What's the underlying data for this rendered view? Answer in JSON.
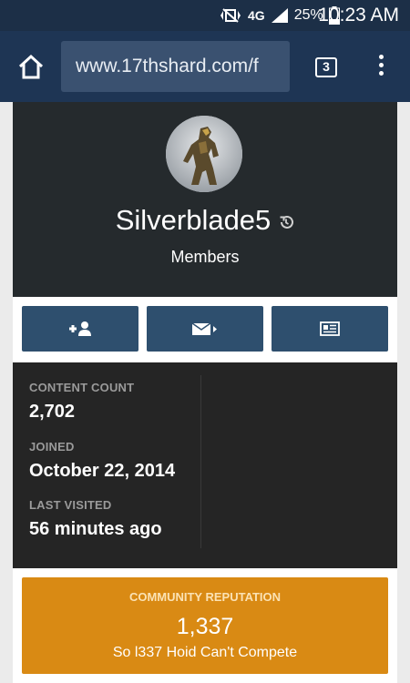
{
  "status_bar": {
    "network": "4G",
    "battery": "25%",
    "time": "10:23 AM"
  },
  "browser": {
    "url": "www.17thshard.com/f",
    "tab_count": "3"
  },
  "profile": {
    "username": "Silverblade5",
    "group": "Members"
  },
  "stats": {
    "content_count_label": "CONTENT COUNT",
    "content_count_value": "2,702",
    "joined_label": "JOINED",
    "joined_value": "October 22, 2014",
    "last_visited_label": "LAST VISITED",
    "last_visited_value": "56 minutes ago"
  },
  "reputation": {
    "title": "COMMUNITY REPUTATION",
    "value": "1,337",
    "description": "So l337 Hoid Can't Compete"
  },
  "colors": {
    "status_bar": "#1c2f47",
    "browser_bar": "#1e3554",
    "url_field": "#3a5170",
    "profile_header": "#252a2d",
    "action_button": "#2e4f6e",
    "stats_bg": "#252525",
    "reputation_bg": "#d98a14"
  },
  "icons": {
    "home": "home-icon",
    "menu": "more-vert-icon",
    "history": "history-icon",
    "follow": "add-user-icon",
    "message": "envelope-icon",
    "content": "newspaper-icon"
  }
}
